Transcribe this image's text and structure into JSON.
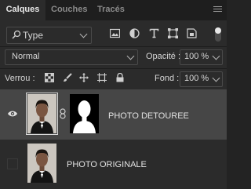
{
  "tabs": [
    {
      "label": "Calques",
      "active": true
    },
    {
      "label": "Couches",
      "active": false
    },
    {
      "label": "Tracés",
      "active": false
    }
  ],
  "filter": {
    "kind_label": "Type",
    "icons": [
      "image-filter-icon",
      "adjustment-filter-icon",
      "type-filter-icon",
      "shape-filter-icon",
      "smart-object-filter-icon"
    ]
  },
  "blend": {
    "mode": "Normal",
    "opacity_label": "Opacité :",
    "opacity_value": "100 %"
  },
  "lock": {
    "label": "Verrou :",
    "icons": [
      "lock-transparent-pixels-icon",
      "lock-image-pixels-icon",
      "lock-position-icon",
      "lock-artboard-icon",
      "lock-all-icon"
    ],
    "fill_label": "Fond :",
    "fill_value": "100 %"
  },
  "layers": [
    {
      "name": "PHOTO DETOUREE",
      "visible": true,
      "selected": true,
      "has_mask": true
    },
    {
      "name": "PHOTO ORIGINALE",
      "visible": false,
      "selected": false,
      "has_mask": false
    }
  ],
  "colors": {
    "panel_bg": "#2b2b2b",
    "tab_bar_bg": "#1e1e1e",
    "selected_layer_bg": "#464646",
    "text": "#d6d6d6"
  }
}
